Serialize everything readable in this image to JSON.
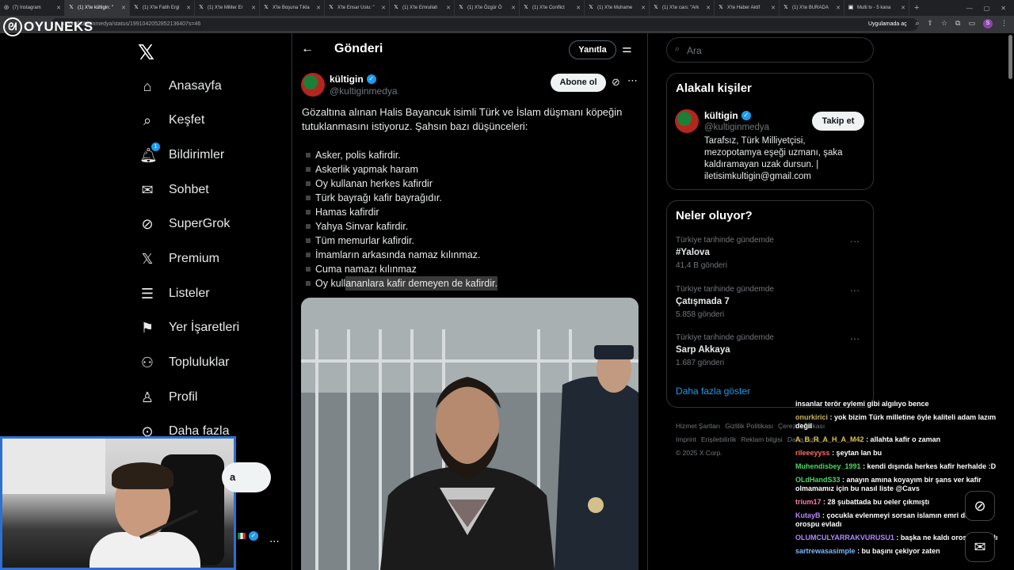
{
  "browser": {
    "tabs": [
      {
        "label": "(7) Instagram",
        "icon": "instagram-icon",
        "active": false
      },
      {
        "label": "(1) X'te kültigin: \"",
        "icon": "x-icon",
        "active": true
      },
      {
        "label": "(1) X'te Fatih Ergi",
        "icon": "x-icon",
        "active": false
      },
      {
        "label": "(1) X'te Militer Er",
        "icon": "x-icon",
        "active": false
      },
      {
        "label": "X'te Boşuna Tıkla",
        "icon": "x-icon",
        "active": false
      },
      {
        "label": "X'te Ensar Uslu: \"",
        "icon": "x-icon",
        "active": false
      },
      {
        "label": "(1) X'te Emrullah",
        "icon": "x-icon",
        "active": false
      },
      {
        "label": "(1) X'te Özgür Ö",
        "icon": "x-icon",
        "active": false
      },
      {
        "label": "(1) X'te Conflict",
        "icon": "x-icon",
        "active": false
      },
      {
        "label": "(1) X'te Muhame",
        "icon": "x-icon",
        "active": false
      },
      {
        "label": "(1) X'te caıs: \"Ark",
        "icon": "x-icon",
        "active": false
      },
      {
        "label": "X'te Haber Aktif",
        "icon": "x-icon",
        "active": false
      },
      {
        "label": "(1) X'te BURADA",
        "icon": "x-icon",
        "active": false
      },
      {
        "label": "Multi tv - 5 kana",
        "icon": "multitv-icon",
        "active": false
      }
    ],
    "url": "x.com/kultiginmedya/status/1991042052852136407s=46",
    "app_button": "Uygulamada aç",
    "profile_letter": "S"
  },
  "overlay": {
    "logo_text": "OYUNEKS"
  },
  "nav": {
    "items": [
      {
        "label": "Anasayfa",
        "icon": "home-icon"
      },
      {
        "label": "Keşfet",
        "icon": "search-icon"
      },
      {
        "label": "Bildirimler",
        "icon": "bell-icon",
        "badge": "1"
      },
      {
        "label": "Sohbet",
        "icon": "mail-icon"
      },
      {
        "label": "SuperGrok",
        "icon": "grok-icon"
      },
      {
        "label": "Premium",
        "icon": "x-icon"
      },
      {
        "label": "Listeler",
        "icon": "list-icon"
      },
      {
        "label": "Yer İşaretleri",
        "icon": "bookmark-icon"
      },
      {
        "label": "Topluluklar",
        "icon": "communities-icon"
      },
      {
        "label": "Profil",
        "icon": "profile-icon"
      },
      {
        "label": "Daha fazla",
        "icon": "more-circle-icon"
      }
    ],
    "post_button": "a"
  },
  "post": {
    "header_title": "Gönderi",
    "reply_button": "Yanıtla",
    "author_name": "kültigin",
    "author_handle": "@kultiginmedya",
    "subscribe_button": "Abone ol",
    "text": "Gözaltına alınan Halis Bayancuk isimli Türk ve İslam düşmanı köpeğin tutuklanmasını istiyoruz. Şahsın bazı düşünceleri:",
    "list": [
      "Asker, polis kafirdir.",
      "Askerlik yapmak haram",
      "Oy kullanan herkes kafirdir",
      "Türk bayrağı kafir bayrağıdır.",
      "Hamas kafirdir",
      "Yahya Sinvar kafirdir.",
      "Tüm memurlar kafirdir.",
      "İmamların arkasında namaz kılınmaz.",
      "Cuma namazı kılınmaz"
    ],
    "last_item_plain": "Oy kull",
    "last_item_highlight": "ananlara kafir demeyen de kafirdir."
  },
  "right": {
    "search_placeholder": "Ara",
    "related_title": "Alakalı kişiler",
    "related_name": "kültigin",
    "related_handle": "@kultiginmedya",
    "follow_button": "Takip et",
    "related_bio": "Tarafsız, Türk Milliyetçisi, mezopotamya eşeği uzmanı, şaka kaldıramayan uzak dursun. | iletisimkultigin@gmail.com",
    "trends_title": "Neler oluyor?",
    "trends": [
      {
        "context": "Türkiye tarihinde gündemde",
        "name": "#Yalova",
        "posts": "41,4 B gönderi"
      },
      {
        "context": "Türkiye tarihinde gündemde",
        "name": "Çatışmada 7",
        "posts": "5.858 gönderi"
      },
      {
        "context": "Türkiye tarihinde gündemde",
        "name": "Sarp Akkaya",
        "posts": "1.687 gönderi"
      }
    ],
    "show_more": "Daha fazla göster",
    "footer_links": [
      "Hizmet Şartları",
      "Gizlilik Politikası",
      "Çerez Politikası",
      "Imprint",
      "Erişilebilirlik",
      "Reklam bilgisi",
      "Daha fazla ..."
    ],
    "copyright": "© 2025 X Corp."
  },
  "chat": [
    {
      "user": "",
      "text": "insanlar terör eylemi gibi algılıyo bence",
      "color": "#ffffff"
    },
    {
      "user": "onurkirici",
      "text": ": yok bizim Türk milletine öyle kaliteli adam lazım değil",
      "color": "#c8b560"
    },
    {
      "user": "A_B_R_A_H_A_M42",
      "text": ": allahta kafir o zaman",
      "color": "#e0c14a"
    },
    {
      "user": "rileeeyyss",
      "text": ": şeytan lan bu",
      "color": "#ff6b6b"
    },
    {
      "user": "Muhendisbey_1991",
      "text": ": kendi dışında herkes kafir herhalde :D",
      "color": "#4cd964"
    },
    {
      "user": "OLdHandS33",
      "text": ": anayın amına koyayım bir şans ver kafir olmamamız için bu nasıl liste @Cavs",
      "color": "#4cd964"
    },
    {
      "user": "trium17",
      "text": ": 28 şubattada bu oeler çıkmıştı",
      "color": "#ff7aa8"
    },
    {
      "user": "KutayB",
      "text": ": çocukla evlenmeyi sorsan islamın emri der ama orospu evladı",
      "color": "#b388ff"
    },
    {
      "user": "OLUMCULYARRAKVURUSU1",
      "text": ": başka ne kaldı orospu evladı",
      "color": "#b388ff"
    },
    {
      "user": "sartrewasasimple",
      "text": ": bu başını çekiyor zaten",
      "color": "#7ab8ff"
    }
  ]
}
